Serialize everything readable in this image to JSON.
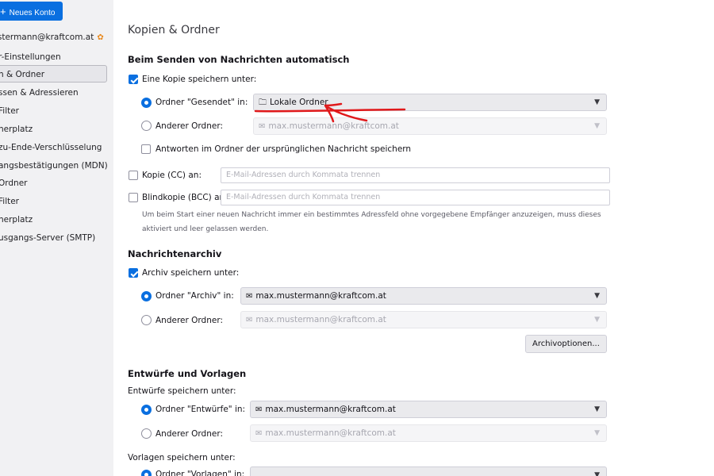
{
  "sidebar": {
    "new_account_label": "Neues Konto",
    "account": "mustermann@kraftcom.at",
    "items": [
      "r-Einstellungen",
      "n & Ordner",
      "ssen & Adressieren",
      "Filter",
      "herplatz",
      "zu-Ende-Verschlüsselung",
      "angsbestätigungen (MDN)",
      "Ordner",
      "Filter",
      "herplatz",
      "usgangs-Server (SMTP)"
    ]
  },
  "main": {
    "page_title": "Kopien & Ordner",
    "send_section": {
      "heading": "Beim Senden von Nachrichten automatisch",
      "save_copy_label": "Eine Kopie speichern unter:",
      "sent_radio_label": "Ordner \"Gesendet\" in:",
      "sent_folder_value": "Lokale Ordner",
      "other_folder_label": "Anderer Ordner:",
      "other_folder_value": "max.mustermann@kraftcom.at",
      "reply_in_folder_label": "Antworten im Ordner der ursprünglichen Nachricht speichern",
      "cc_label": "Kopie (CC) an:",
      "cc_placeholder": "E-Mail-Adressen durch Kommata trennen",
      "bcc_label": "Blindkopie (BCC) an:",
      "bcc_placeholder": "E-Mail-Adressen durch Kommata trennen",
      "hint": "Um beim Start einer neuen Nachricht immer ein bestimmtes Adressfeld ohne vorgegebene Empfänger anzuzeigen, muss dieses aktiviert und leer gelassen werden."
    },
    "archive_section": {
      "heading": "Nachrichtenarchiv",
      "save_archive_label": "Archiv speichern unter:",
      "archive_radio_label": "Ordner \"Archiv\" in:",
      "archive_folder_value": "max.mustermann@kraftcom.at",
      "other_folder_label": "Anderer Ordner:",
      "other_folder_value": "max.mustermann@kraftcom.at",
      "options_button": "Archivoptionen..."
    },
    "drafts_section": {
      "heading": "Entwürfe und Vorlagen",
      "drafts_save_label": "Entwürfe speichern unter:",
      "drafts_radio_label": "Ordner \"Entwürfe\" in:",
      "drafts_folder_value": "max.mustermann@kraftcom.at",
      "other_folder_label": "Anderer Ordner:",
      "other_folder_value": "max.mustermann@kraftcom.at",
      "templates_save_label": "Vorlagen speichern unter:",
      "templates_radio_label": "Ordner \"Vorlagen\" in:"
    }
  },
  "colors": {
    "accent": "#0a6fe0",
    "annotation": "#e0191b"
  }
}
